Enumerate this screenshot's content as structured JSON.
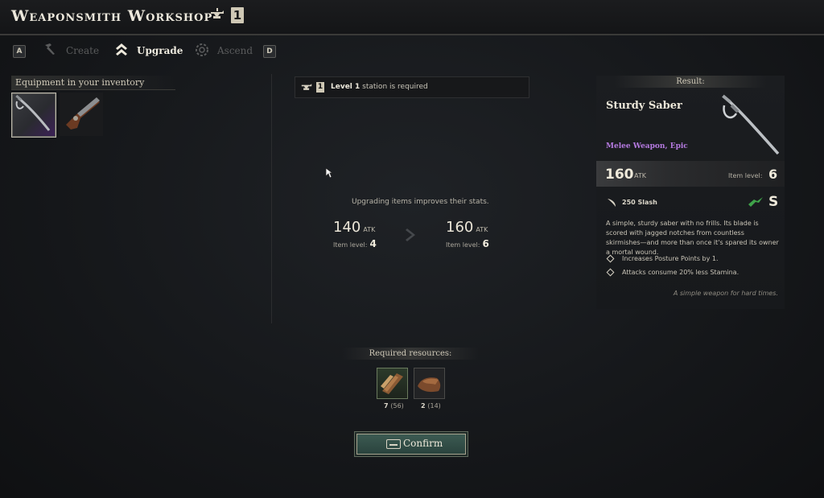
{
  "header": {
    "title": "Weaponsmith Workshop",
    "station_level": "1"
  },
  "tabs": {
    "prev_key": "A",
    "next_key": "D",
    "items": [
      {
        "label": "Create",
        "icon": "hammer-icon",
        "state": "disabled"
      },
      {
        "label": "Upgrade",
        "icon": "upgrade-chevrons-icon",
        "state": "active"
      },
      {
        "label": "Ascend",
        "icon": "ascend-gear-icon",
        "state": "disabled"
      }
    ]
  },
  "inventory": {
    "heading": "Equipment in your inventory",
    "items": [
      {
        "name": "saber",
        "icon": "saber-icon",
        "selected": true,
        "rarity_color": "#6a3aa0"
      },
      {
        "name": "flintlock-pistol",
        "icon": "pistol-icon",
        "selected": false
      }
    ]
  },
  "requirement": {
    "level_badge": "1",
    "level_text": "Level 1",
    "rest": "station is required"
  },
  "upgrade": {
    "note": "Upgrading items improves their stats.",
    "from": {
      "atk": "140",
      "atk_unit": "ATK",
      "level_label": "Item level:",
      "level": "4"
    },
    "to": {
      "atk": "160",
      "atk_unit": "ATK",
      "level_label": "Item level:",
      "level": "6"
    }
  },
  "resources": {
    "heading": "Required resources:",
    "items": [
      {
        "name": "wood",
        "icon": "wood-plank-icon",
        "required": "7",
        "owned": "(56)"
      },
      {
        "name": "leather",
        "icon": "leather-icon",
        "required": "2",
        "owned": "(14)"
      }
    ]
  },
  "confirm": {
    "label": "Confirm"
  },
  "result": {
    "heading": "Result:",
    "name": "Sturdy Saber",
    "type": "Melee Weapon, Epic",
    "atk": "160",
    "atk_unit": "ATK",
    "item_level_label": "Item level:",
    "item_level": "6",
    "damage": "250 Slash",
    "scaling_grade": "S",
    "description": "A simple, sturdy saber with no frills. Its blade is scored with jagged notches from countless skirmishes—and more than once it's spared its owner a mortal wound.",
    "perks": [
      "Increases Posture Points by 1.",
      "Attacks consume 20% less Stamina."
    ],
    "flavor": "A simple weapon for hard times."
  },
  "colors": {
    "epic": "#b57ae0",
    "confirm_bg": "#34504a",
    "scaling_green": "#3fa34a"
  }
}
